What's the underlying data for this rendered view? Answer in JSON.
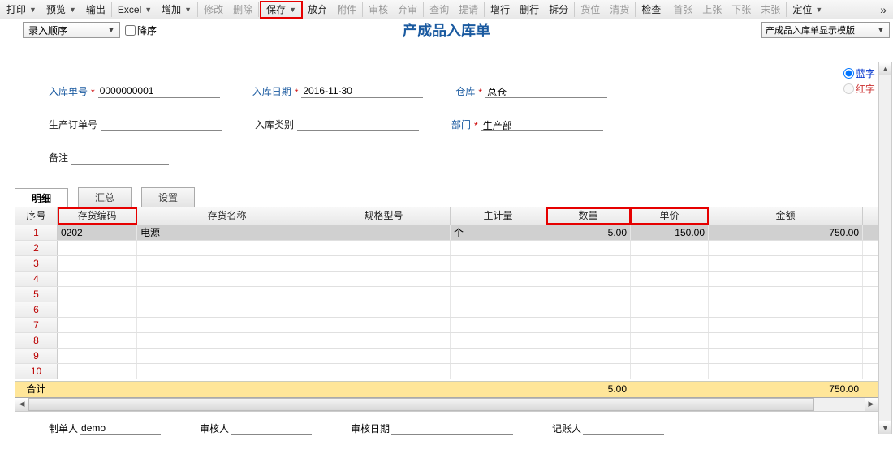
{
  "toolbar": {
    "print": "打印",
    "preview": "预览",
    "output": "输出",
    "excel": "Excel",
    "add": "增加",
    "modify": "修改",
    "delete": "删除",
    "save": "保存",
    "abandon": "放弃",
    "attach": "附件",
    "audit": "审核",
    "unaudit": "弃审",
    "query": "查询",
    "submit": "提请",
    "addrow": "增行",
    "delrow": "删行",
    "split": "拆分",
    "loc": "货位",
    "clear": "清货",
    "check": "检查",
    "first": "首张",
    "prev": "上张",
    "next": "下张",
    "last": "末张",
    "locate": "定位",
    "overflow": "»"
  },
  "bar2": {
    "order": "录入顺序",
    "desc": "降序",
    "title": "产成品入库单",
    "template": "产成品入库单显示模版"
  },
  "radios": {
    "blue": "蓝字",
    "red": "红字"
  },
  "form": {
    "rkdh_lbl": "入库单号",
    "rkdh_val": "0000000001",
    "rkrq_lbl": "入库日期",
    "rkrq_val": "2016-11-30",
    "ck_lbl": "仓库",
    "ck_val": "总仓",
    "scdd_lbl": "生产订单号",
    "scdd_val": "",
    "rklb_lbl": "入库类别",
    "rklb_val": "",
    "bm_lbl": "部门",
    "bm_val": "生产部",
    "bz_lbl": "备注",
    "bz_val": ""
  },
  "tabs": {
    "detail": "明细",
    "summary": "汇总",
    "settings": "设置"
  },
  "grid": {
    "cols": [
      "序号",
      "存货编码",
      "存货名称",
      "规格型号",
      "主计量",
      "数量",
      "单价",
      "金额"
    ],
    "rows": [
      {
        "n": "1",
        "code": "0202",
        "name": "电源",
        "spec": "",
        "uom": "个",
        "qty": "5.00",
        "price": "150.00",
        "amt": "750.00"
      },
      {
        "n": "2"
      },
      {
        "n": "3"
      },
      {
        "n": "4"
      },
      {
        "n": "5"
      },
      {
        "n": "6"
      },
      {
        "n": "7"
      },
      {
        "n": "8"
      },
      {
        "n": "9"
      },
      {
        "n": "10"
      }
    ],
    "total_lbl": "合计",
    "total_qty": "5.00",
    "total_amt": "750.00"
  },
  "footer": {
    "maker_lbl": "制单人",
    "maker_val": "demo",
    "auditor_lbl": "审核人",
    "auditor_val": "",
    "adate_lbl": "审核日期",
    "adate_val": "",
    "booker_lbl": "记账人",
    "booker_val": ""
  }
}
